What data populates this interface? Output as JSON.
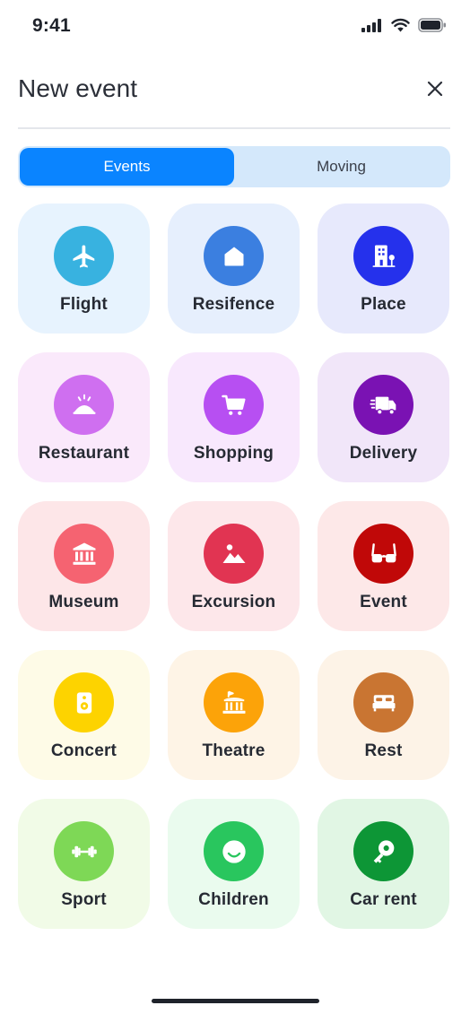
{
  "status_bar": {
    "time": "9:41"
  },
  "header": {
    "title": "New event",
    "close_icon": "close-icon"
  },
  "tabs": [
    {
      "label": "Events",
      "active": true
    },
    {
      "label": "Moving",
      "active": false
    }
  ],
  "colors": {
    "accent": "#0a84ff",
    "tab_track": "#d4e8fb"
  },
  "categories": [
    {
      "label": "Flight",
      "icon": "airplane-icon",
      "tile_bg": "#e7f3fe",
      "circle": "#38b2e0"
    },
    {
      "label": "Resifence",
      "icon": "home-icon",
      "tile_bg": "#e6effd",
      "circle": "#3b7fe0"
    },
    {
      "label": "Place",
      "icon": "building-icon",
      "tile_bg": "#e7e9fc",
      "circle": "#2531ec"
    },
    {
      "label": "Restaurant",
      "icon": "serving-dish-icon",
      "tile_bg": "#fae9fb",
      "circle": "#cf6ff0"
    },
    {
      "label": "Shopping",
      "icon": "shopping-cart-icon",
      "tile_bg": "#f8e8fd",
      "circle": "#b74ff2"
    },
    {
      "label": "Delivery",
      "icon": "delivery-truck-icon",
      "tile_bg": "#f1e6f9",
      "circle": "#7a12b3"
    },
    {
      "label": "Museum",
      "icon": "museum-icon",
      "tile_bg": "#fde6e8",
      "circle": "#f56371"
    },
    {
      "label": "Excursion",
      "icon": "landscape-icon",
      "tile_bg": "#fde7ea",
      "circle": "#e13452"
    },
    {
      "label": "Event",
      "icon": "glasses-icon",
      "tile_bg": "#fde8e8",
      "circle": "#c00808"
    },
    {
      "label": "Concert",
      "icon": "speaker-icon",
      "tile_bg": "#fefbe7",
      "circle": "#fdd300"
    },
    {
      "label": "Theatre",
      "icon": "theatre-icon",
      "tile_bg": "#fef4e6",
      "circle": "#fca309"
    },
    {
      "label": "Rest",
      "icon": "bed-icon",
      "tile_bg": "#fdf3e7",
      "circle": "#c97532"
    },
    {
      "label": "Sport",
      "icon": "dumbbell-icon",
      "tile_bg": "#f1fbe7",
      "circle": "#7ed856"
    },
    {
      "label": "Children",
      "icon": "smiley-icon",
      "tile_bg": "#eafbee",
      "circle": "#29c65e"
    },
    {
      "label": "Car rent",
      "icon": "car-key-icon",
      "tile_bg": "#e1f6e4",
      "circle": "#0d9636"
    }
  ]
}
